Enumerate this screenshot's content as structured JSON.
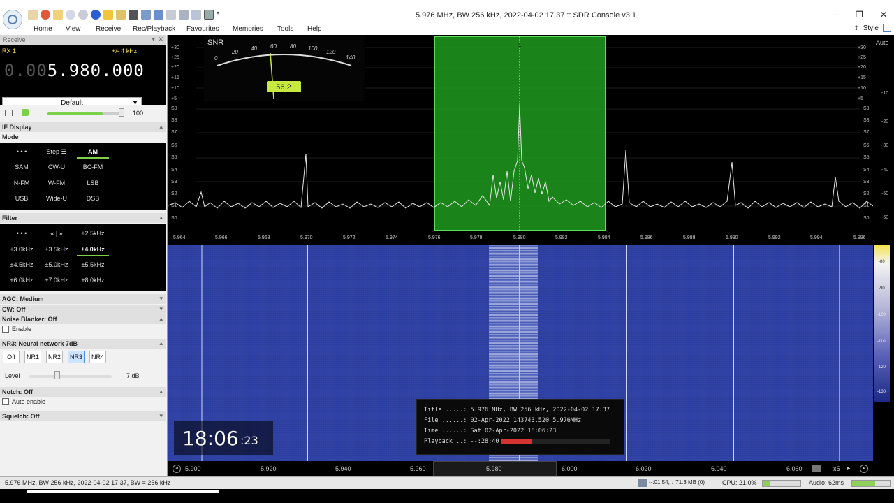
{
  "window": {
    "title": "5.976 MHz, BW 256 kHz, 2022-04-02 17:37 :: SDR Console v3.1",
    "min": "─",
    "max": "❐",
    "close": "✕"
  },
  "menu": [
    "Home",
    "View",
    "Receive",
    "Rec/Playback",
    "Favourites",
    "Memories",
    "Tools",
    "Help"
  ],
  "style_label": "Style",
  "receive_panel": {
    "header": "Receive",
    "rx_label": "RX 1",
    "bandwidth": "+/- 4 kHz",
    "freq_dim": "0.00",
    "freq_main": "5.980.000",
    "profile": "Default",
    "volume": "100",
    "volume_level": 0.72,
    "if_display": "IF Display",
    "mode_title": "Mode",
    "modes": [
      "• • •",
      "Step ☰",
      "AM",
      "SAM",
      "CW-U",
      "BC-FM",
      "N-FM",
      "W-FM",
      "LSB",
      "USB",
      "Wide-U",
      "DSB"
    ],
    "active_mode": "AM",
    "filter_title": "Filter",
    "filters": [
      "• • •",
      "« | »",
      "±2.5kHz",
      "±3.0kHz",
      "±3.5kHz",
      "±4.0kHz",
      "±4.5kHz",
      "±5.0kHz",
      "±5.5kHz",
      "±6.0kHz",
      "±7.0kHz",
      "±8.0kHz"
    ],
    "active_filter": "±4.0kHz",
    "agc": "AGC: Medium",
    "cw": "CW: Off",
    "noise_blanker": "Noise Blanker: Off",
    "nb_enable": "Enable",
    "nr": "NR3: Neural network 7dB",
    "nr_buttons": [
      "Off",
      "NR1",
      "NR2",
      "NR3",
      "NR4"
    ],
    "active_nr": "NR3",
    "level_label": "Level",
    "level_value": "7 dB",
    "notch": "Notch: Off",
    "auto_enable": "Auto enable",
    "squelch": "Squelch: Off"
  },
  "spectrum": {
    "snr_label": "SNR",
    "snr_scale": [
      "0",
      "20",
      "40",
      "60",
      "80",
      "100",
      "120",
      "140"
    ],
    "snr_value": "56.2",
    "channel_marker": "1",
    "auto": "Auto",
    "left_scale": [
      "+30",
      "+25",
      "+20",
      "+15",
      "+10",
      "+5",
      "S9",
      "S8",
      "S7",
      "S6",
      "S5",
      "S4",
      "S3",
      "S2",
      "S1",
      "S0"
    ],
    "right_db": [
      "-10",
      "-20",
      "-30",
      "-40",
      "-50",
      "-60"
    ],
    "freq_labels": [
      "5.964",
      "5.966",
      "5.968",
      "5.970",
      "5.972",
      "5.974",
      "5.976",
      "5.978",
      "5.980",
      "5.982",
      "5.984",
      "5.986",
      "5.988",
      "5.990",
      "5.992",
      "5.994",
      "5.996"
    ]
  },
  "waterfall": {
    "scale": [
      "-80",
      "-90",
      "-100",
      "-110",
      "-120",
      "-130"
    ],
    "clock_hm": "18:06",
    "clock_s": ":23",
    "info": {
      "title_line": "Title .....: 5.976 MHz, BW 256 kHz, 2022-04-02 17:37",
      "file_line": "File ......: 02-Apr-2022 143743.520 5.976MHz",
      "time_line": "Time ......: Sat 02-Apr-2022 18:06:23",
      "playback_line": "Playback ..: --:28:40",
      "playback_progress": 0.28
    },
    "bottom_labels": [
      "5.900",
      "5.920",
      "5.940",
      "5.960",
      "5.980",
      "6.000",
      "6.020",
      "6.040",
      "6.060"
    ],
    "zoom": "x5"
  },
  "status": {
    "left": "5.976 MHz, BW 256 kHz, 2022-04-02 17:37, BW = 256 kHz",
    "rec": "--:01:54, ↓ 71.3 MB (0)",
    "cpu": "CPU: 21.0%",
    "cpu_level": 0.21,
    "audio": "Audio: 62ms",
    "audio_level": 0.62
  }
}
